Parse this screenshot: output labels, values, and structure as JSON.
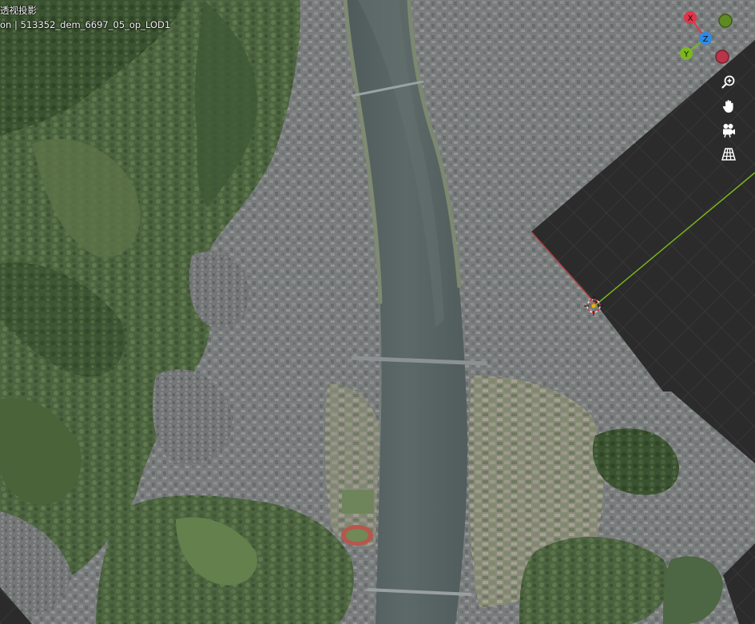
{
  "viewport": {
    "view_mode": "透视投影",
    "object_info": "on | 513352_dem_6697_05_op_LOD1"
  },
  "gizmo": {
    "x_label": "X",
    "y_label": "Y",
    "z_label": "Z",
    "x_color": "#e0344a",
    "y_color": "#7bb61f",
    "z_color": "#2d8be6",
    "neg_x_color": "#b8354a",
    "neg_y_color": "#5f8a22"
  },
  "nav": {
    "zoom_icon": "magnifier-plus-icon",
    "pan_icon": "hand-icon",
    "camera_icon": "camera-icon",
    "ortho_icon": "grid-perspective-icon"
  },
  "colors": {
    "grid_background": "#2b2b2b",
    "grid_line": "#3d3d3d",
    "y_axis_line": "#7bb61f",
    "x_axis_line": "#c23a3a",
    "river": "#55605f",
    "forest_dark": "#3e5632",
    "forest": "#566b45",
    "urban": "#7d7f80"
  }
}
